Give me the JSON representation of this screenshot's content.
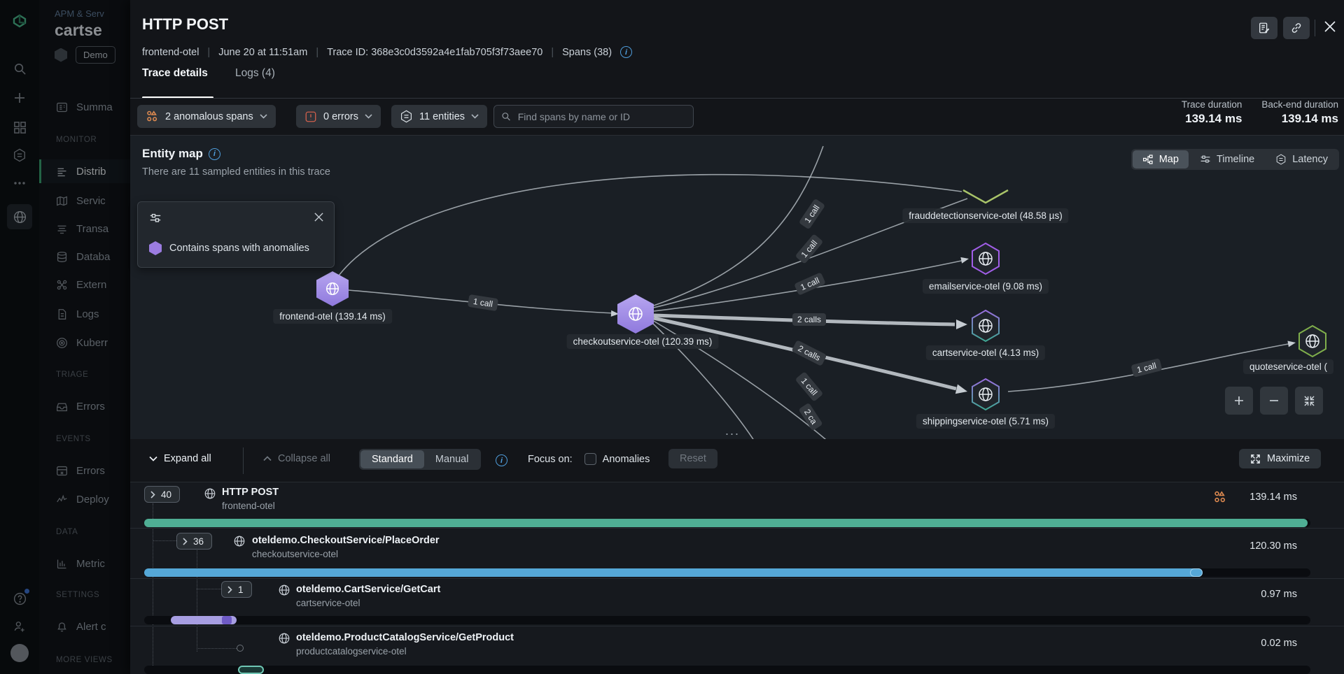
{
  "sidebar": {
    "breadcrumb": "APM & Serv",
    "title": "cartse",
    "env": "Demo",
    "nav": {
      "summary": "Summa",
      "monitor_label": "MONITOR",
      "monitor": [
        "Distrib",
        "Servic",
        "Transa",
        "Databa",
        "Extern",
        "Logs",
        "Kuberr"
      ],
      "triage_label": "TRIAGE",
      "triage": [
        "Errors"
      ],
      "events_label": "EVENTS",
      "events": [
        "Errors",
        "Deploy"
      ],
      "data_label": "DATA",
      "data": [
        "Metric"
      ],
      "settings_label": "SETTINGS",
      "settings": [
        "Alert c"
      ],
      "more_label": "MORE VIEWS"
    }
  },
  "flyout": {
    "title": "HTTP POST",
    "meta": {
      "service": "frontend-otel",
      "date": "June 20 at 11:51am",
      "trace_id": "Trace ID: 368e3c0d3592a4e1fab705f3f73aee70",
      "spans": "Spans (38)"
    },
    "tabs": [
      {
        "label": "Trace details"
      },
      {
        "label": "Logs (4)"
      }
    ],
    "filters": {
      "anomalous": "2 anomalous spans",
      "errors": "0 errors",
      "entities": "11 entities",
      "search_placeholder": "Find spans by name or ID"
    },
    "durations": {
      "trace_label": "Trace duration",
      "trace_value": "139.14 ms",
      "backend_label": "Back-end duration",
      "backend_value": "139.14 ms"
    }
  },
  "entity_map": {
    "title": "Entity map",
    "subtitle": "There are 11 sampled entities in this trace",
    "legend": "Contains spans with anomalies",
    "views": [
      "Map",
      "Timeline",
      "Latency"
    ],
    "nodes": {
      "frontend": "frontend-otel (139.14 ms)",
      "checkout": "checkoutservice-otel (120.39 ms)",
      "fraud": "frauddetectionservice-otel (48.58 µs)",
      "email": "emailservice-otel (9.08 ms)",
      "cart": "cartservice-otel (4.13 ms)",
      "shipping": "shippingservice-otel (5.71 ms)",
      "quote": "quoteservice-otel ("
    },
    "edge_labels": [
      "1 call",
      "1 call",
      "1 call",
      "1 call",
      "2 calls",
      "2 calls",
      "1 call",
      "2 ca",
      "1 call"
    ],
    "more_handle": "..."
  },
  "waterfall": {
    "controls": {
      "expand": "Expand all",
      "collapse": "Collapse all",
      "standard": "Standard",
      "manual": "Manual",
      "focus": "Focus on:",
      "anomalies": "Anomalies",
      "reset": "Reset",
      "maximize": "Maximize"
    },
    "rows": [
      {
        "badge": "40",
        "name": "HTTP POST",
        "service": "frontend-otel",
        "duration": "139.14 ms"
      },
      {
        "badge": "36",
        "name": "oteldemo.CheckoutService/PlaceOrder",
        "service": "checkoutservice-otel",
        "duration": "120.30 ms"
      },
      {
        "badge": "1",
        "name": "oteldemo.CartService/GetCart",
        "service": "cartservice-otel",
        "duration": "0.97 ms"
      },
      {
        "badge": "",
        "name": "oteldemo.ProductCatalogService/GetProduct",
        "service": "productcatalogservice-otel",
        "duration": "0.02 ms"
      }
    ],
    "bar_colors": {
      "root": "#4fae94",
      "checkout": "#55a8d8",
      "cart": "#a79ee2",
      "cart_segment": "#6f5bc6",
      "product": "#6fc7b4"
    }
  }
}
